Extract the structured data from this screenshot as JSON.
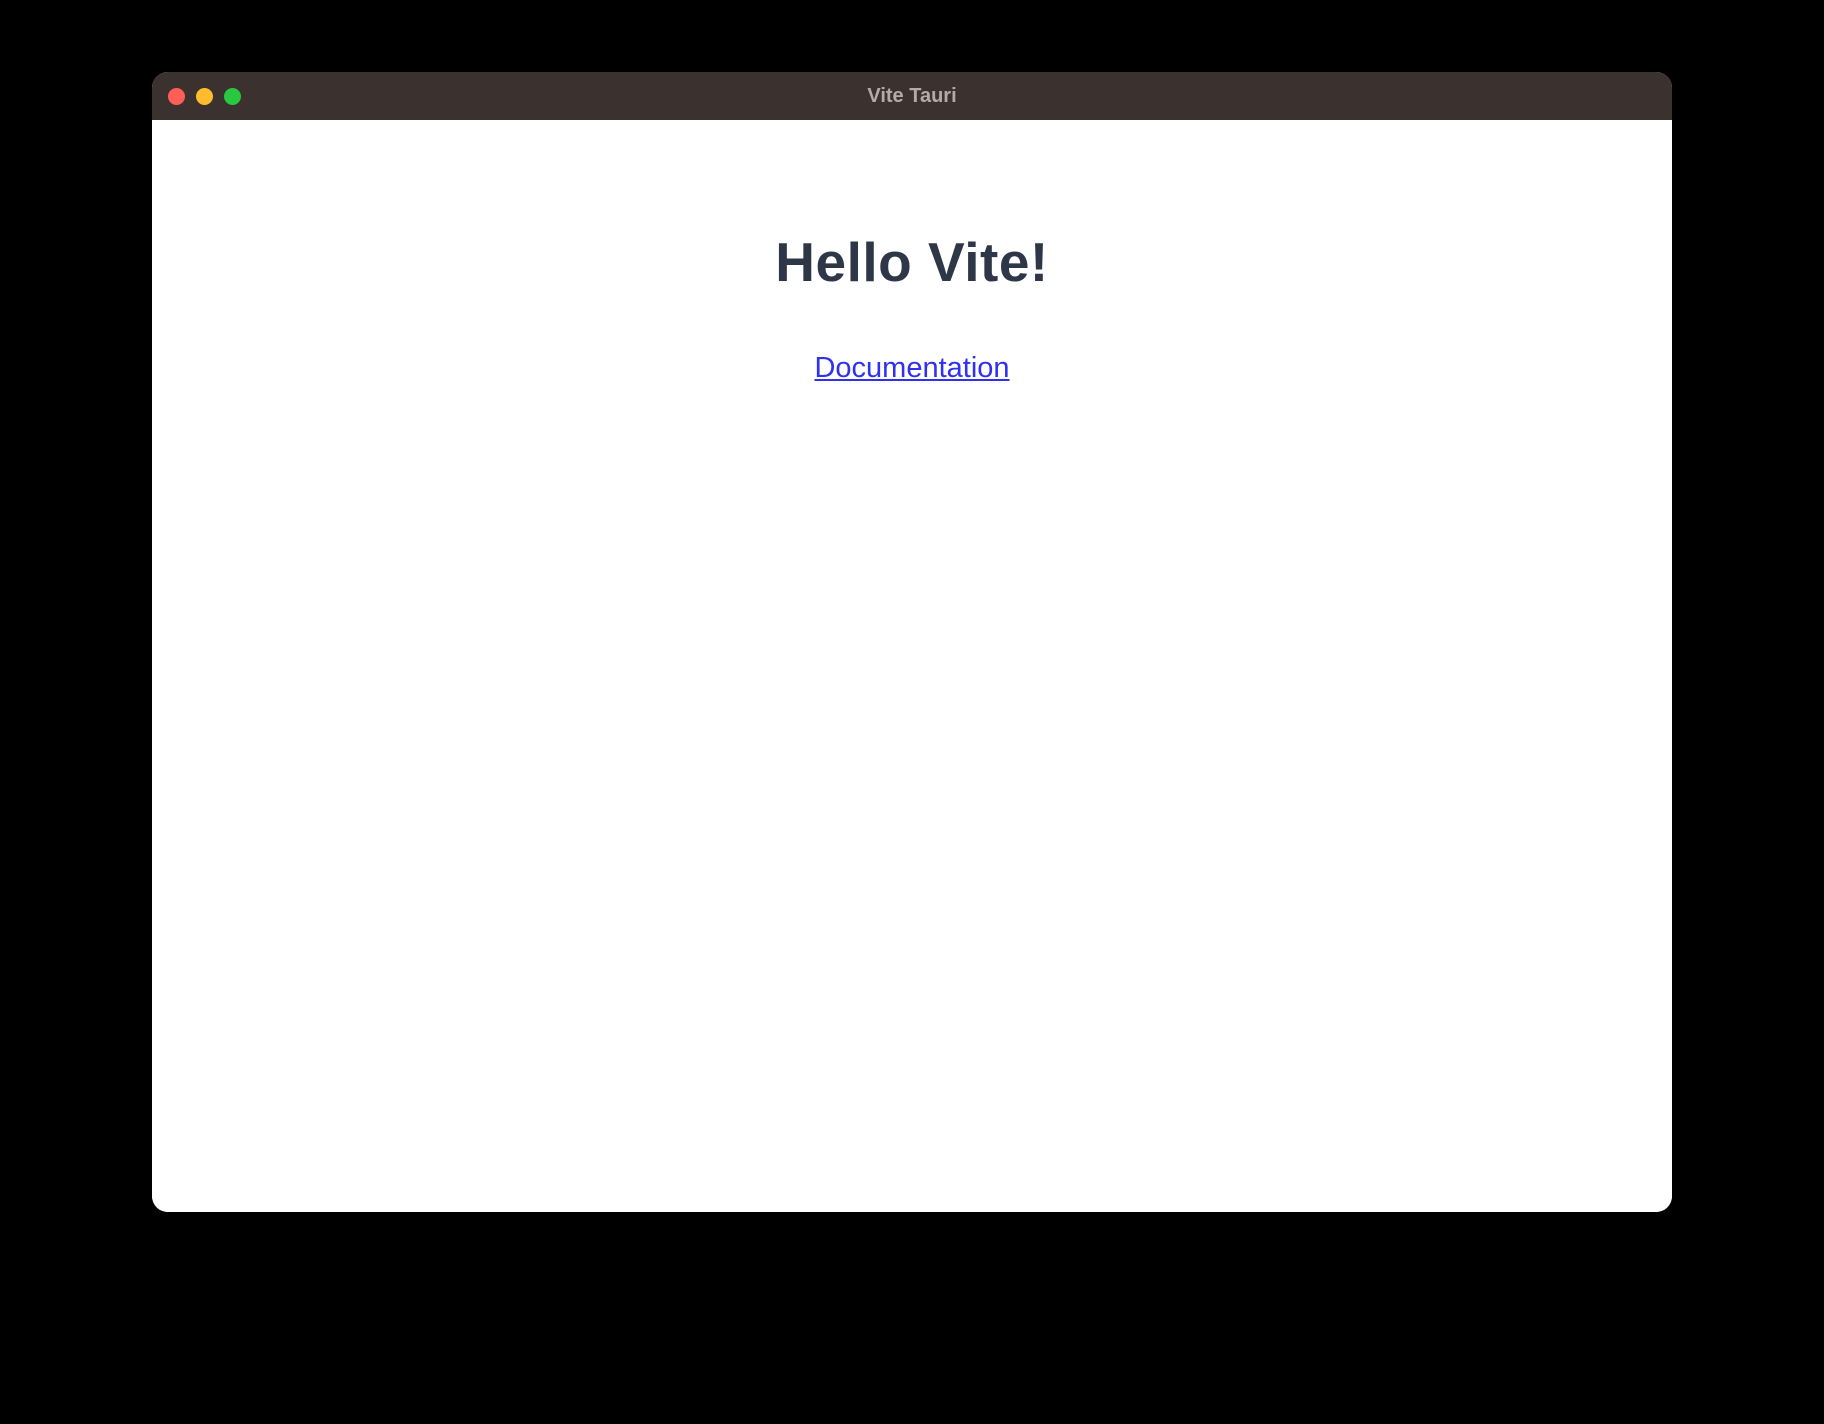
{
  "window": {
    "title": "Vite Tauri"
  },
  "content": {
    "heading": "Hello Vite!",
    "documentation_link": "Documentation"
  }
}
